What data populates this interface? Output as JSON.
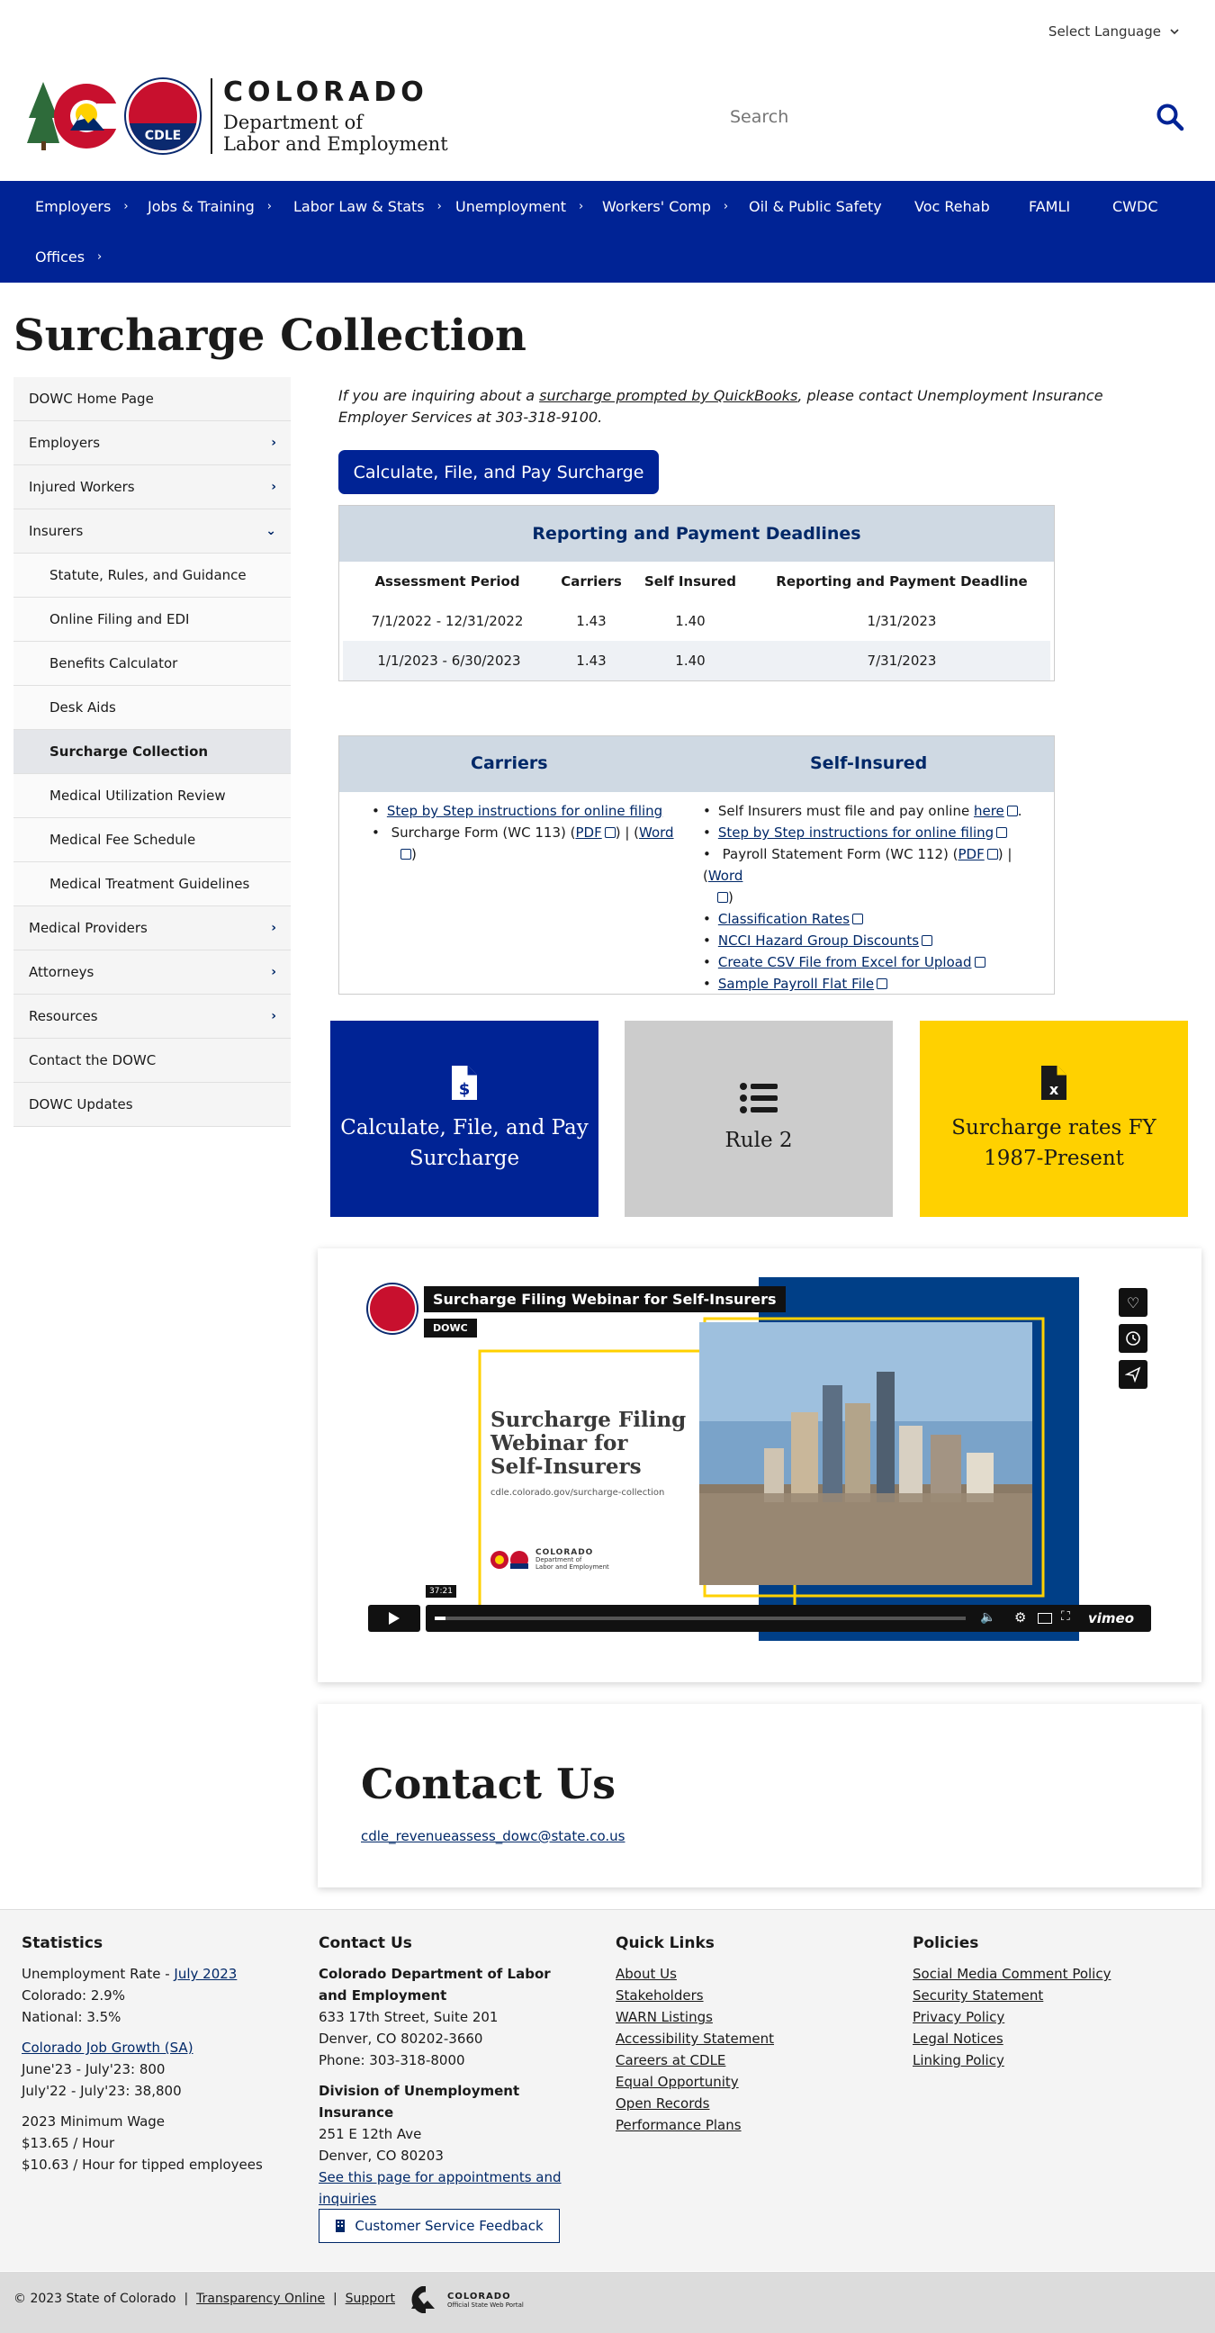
{
  "header": {
    "language": "Select Language",
    "state": "COLORADO",
    "dept_line1": "Department of",
    "dept_line2": "Labor and Employment",
    "seal_text": "CDLE",
    "search_placeholder": "Search"
  },
  "nav": {
    "items": [
      {
        "label": "Employers",
        "chevron": true
      },
      {
        "label": "Jobs & Training",
        "chevron": true
      },
      {
        "label": "Labor Law & Stats",
        "chevron": true
      },
      {
        "label": "Unemployment",
        "chevron": true
      },
      {
        "label": "Workers' Comp",
        "chevron": true
      },
      {
        "label": "Oil & Public Safety",
        "chevron": false
      },
      {
        "label": "Voc Rehab",
        "chevron": false
      },
      {
        "label": "FAMLI",
        "chevron": false
      },
      {
        "label": "CWDC",
        "chevron": false
      },
      {
        "label": "Offices",
        "chevron": true
      }
    ]
  },
  "page": {
    "title": "Surcharge Collection"
  },
  "sidebar": {
    "items": [
      {
        "label": "DOWC Home Page",
        "sub": false,
        "chevron": "",
        "active": false
      },
      {
        "label": "Employers",
        "sub": false,
        "chevron": "›",
        "active": false
      },
      {
        "label": "Injured Workers",
        "sub": false,
        "chevron": "›",
        "active": false
      },
      {
        "label": "Insurers",
        "sub": false,
        "chevron": "⌄",
        "active": false
      },
      {
        "label": "Statute, Rules, and Guidance",
        "sub": true,
        "chevron": "",
        "active": false
      },
      {
        "label": "Online Filing and EDI",
        "sub": true,
        "chevron": "",
        "active": false
      },
      {
        "label": "Benefits Calculator",
        "sub": true,
        "chevron": "",
        "active": false
      },
      {
        "label": "Desk Aids",
        "sub": true,
        "chevron": "",
        "active": false
      },
      {
        "label": "Surcharge Collection",
        "sub": true,
        "chevron": "",
        "active": true
      },
      {
        "label": "Medical Utilization Review",
        "sub": true,
        "chevron": "",
        "active": false
      },
      {
        "label": "Medical Fee Schedule",
        "sub": true,
        "chevron": "",
        "active": false
      },
      {
        "label": "Medical Treatment Guidelines",
        "sub": true,
        "chevron": "",
        "active": false
      },
      {
        "label": "Medical Providers",
        "sub": false,
        "chevron": "›",
        "active": false
      },
      {
        "label": "Attorneys",
        "sub": false,
        "chevron": "›",
        "active": false
      },
      {
        "label": "Resources",
        "sub": false,
        "chevron": "›",
        "active": false
      },
      {
        "label": "Contact the DOWC",
        "sub": false,
        "chevron": "",
        "active": false
      },
      {
        "label": "DOWC Updates",
        "sub": false,
        "chevron": "",
        "active": false
      }
    ]
  },
  "intro": {
    "before": "If you are inquiring about a ",
    "link": "surcharge prompted by QuickBooks",
    "after": ", please contact Unemployment Insurance Employer Services at 303-318-9100."
  },
  "primary_button": "Calculate, File, and Pay Surcharge",
  "deadlines": {
    "title": "Reporting and Payment Deadlines",
    "headers": [
      "Assessment Period",
      "Carriers",
      "Self Insured",
      "Reporting and Payment Deadline"
    ],
    "rows": [
      [
        "7/1/2022 - 12/31/2022",
        "1.43",
        "1.40",
        "1/31/2023"
      ],
      [
        "1/1/2023 - 6/30/2023",
        "1.43",
        "1.40",
        "7/31/2023"
      ]
    ]
  },
  "resources": {
    "carriers_title": "Carriers",
    "self_title": "Self-Insured",
    "carriers": {
      "step_link": "Step by Step instructions for online filing",
      "form_text": "Surcharge Form (WC 113) (",
      "pdf": "PDF",
      "sep": ") | (",
      "word": "Word",
      "close": ")"
    },
    "self": {
      "must_text": "Self Insurers must file and pay online ",
      "here": "here",
      "period": ".",
      "step_link": "Step by Step instructions for online filing",
      "payroll_text": "Payroll Statement Form (WC 112) (",
      "pdf": "PDF",
      "sep": ") | (",
      "word": "Word",
      "close": ")",
      "links": [
        "Classification Rates",
        "NCCI Hazard Group Discounts",
        "Create CSV File from Excel for Upload",
        "Sample Payroll Flat File"
      ]
    }
  },
  "tiles": [
    {
      "label": "Calculate, File, and Pay Surcharge",
      "icon": "file-dollar-icon",
      "bg": "#002395",
      "fg": "#ffffff"
    },
    {
      "label": "Rule 2",
      "icon": "list-icon",
      "bg": "#cccccc",
      "fg": "#1a1a1a"
    },
    {
      "label": "Surcharge rates FY 1987-Present",
      "icon": "file-excel-icon",
      "bg": "#ffd100",
      "fg": "#1a1a1a"
    }
  ],
  "video": {
    "title": "Surcharge Filing Webinar for Self-Insurers",
    "channel": "DOWC",
    "slide_title_1": "Surcharge Filing",
    "slide_title_2": "Webinar for",
    "slide_title_3": "Self-Insurers",
    "slide_url": "cdle.colorado.gov/surcharge-collection",
    "duration": "37:21",
    "brand": "vimeo",
    "mini_logo_state": "COLORADO",
    "mini_logo_dept": "Department of",
    "mini_logo_dept2": "Labor and Employment",
    "progress_fraction": 0.02
  },
  "contact": {
    "title": "Contact Us",
    "email": "cdle_revenueassess_dowc@state.co.us"
  },
  "footer": {
    "statistics": {
      "title": "Statistics",
      "unemp_label": "Unemployment Rate - ",
      "unemp_link": "July 2023",
      "colorado": "Colorado: 2.9%",
      "national": "National: 3.5%",
      "growth_link": "Colorado Job Growth (SA)",
      "growth_1": "June'23 - July'23: 800",
      "growth_2": "July'22 - July'23: 38,800",
      "wage_title": "2023 Minimum Wage",
      "wage_1": "$13.65 / Hour",
      "wage_2": "$10.63 / Hour for tipped employees"
    },
    "contact": {
      "title": "Contact Us",
      "org": "Colorado Department of Labor and Employment",
      "addr1": "633 17th Street, Suite 201",
      "addr2": "Denver, CO  80202-3660",
      "phone": "Phone: 303-318-8000",
      "div": "Division of Unemployment Insurance",
      "div_addr1": "251 E 12th Ave",
      "div_addr2": "Denver, CO  80203",
      "appt_link": "See this page for appointments and inquiries",
      "feedback": "Customer Service Feedback"
    },
    "quick_links": {
      "title": "Quick Links",
      "items": [
        "About Us",
        "Stakeholders",
        "WARN Listings",
        "Accessibility Statement",
        "Careers at CDLE",
        "Equal Opportunity",
        "Open Records",
        "Performance Plans"
      ]
    },
    "policies": {
      "title": "Policies",
      "items": [
        "Social Media Comment Policy",
        "Security Statement",
        "Privacy Policy",
        "Legal Notices",
        "Linking Policy"
      ]
    },
    "bottom": {
      "copyright": "© 2023 State of Colorado",
      "sep": "|",
      "transparency": "Transparency Online",
      "support": "Support",
      "portal_1": "COLORADO",
      "portal_2": "Official State Web Portal"
    }
  }
}
